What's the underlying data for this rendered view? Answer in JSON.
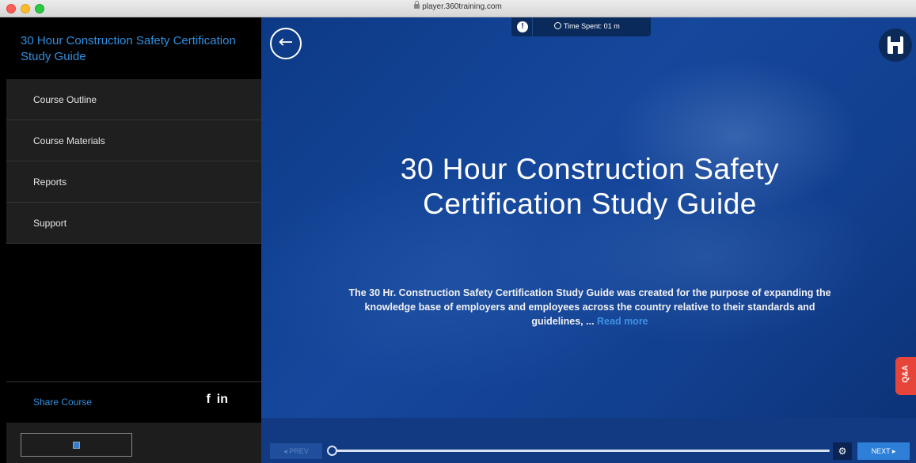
{
  "browser": {
    "url": "player.360training.com"
  },
  "sidebar": {
    "title": "30 Hour Construction Safety Certification Study Guide",
    "items": [
      {
        "label": "Course Outline"
      },
      {
        "label": "Course Materials"
      },
      {
        "label": "Reports"
      },
      {
        "label": "Support"
      }
    ],
    "share_label": "Share Course",
    "share_facebook": "f",
    "share_linkedin": "in"
  },
  "header": {
    "info_icon": "!",
    "timer_text": "Time Spent: 01 m"
  },
  "main": {
    "title": "30 Hour Construction Safety Certification Study Guide",
    "description": "The 30 Hr. Construction Safety Certification Study Guide was created for the purpose of expanding the knowledge base of employers and employees across the country relative to their standards and guidelines, ...",
    "read_more": "Read more",
    "qa_label": "Q&A"
  },
  "controls": {
    "prev_label": "◂  PREV",
    "next_label": "NEXT  ▸",
    "settings_icon": "⚙",
    "progress": 0.0
  },
  "colors": {
    "accent": "#2f8fdf",
    "stage_blue": "#15479c",
    "qa_red": "#e8453a",
    "next_blue": "#2e7fd8"
  },
  "icons": {
    "back": "arrow-left-icon",
    "save": "floppy-disk-icon",
    "clock": "clock-icon",
    "settings": "gear-icon",
    "info": "info-icon"
  }
}
